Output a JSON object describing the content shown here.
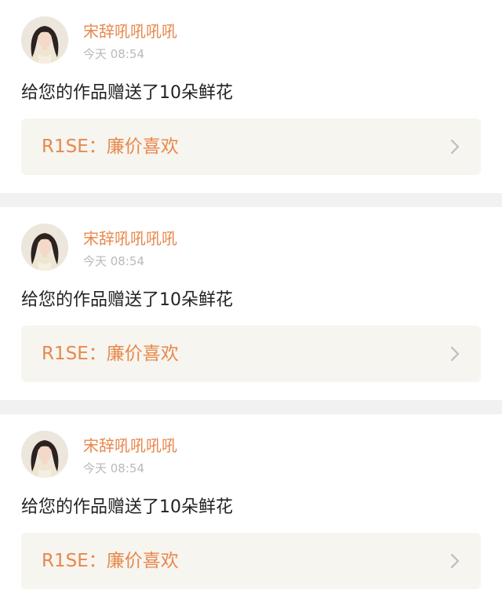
{
  "colors": {
    "accent": "#e8884c",
    "timestamp": "#b9b9b9",
    "text": "#222222",
    "link_bg": "#f6f5f0",
    "separator": "#f1f1f1"
  },
  "notifications": [
    {
      "avatar_icon": "user-avatar-icon",
      "username": "宋辞吼吼吼吼",
      "time": "今天 08:54",
      "message": "给您的作品赠送了10朵鲜花",
      "work_title": "R1SE：廉价喜欢",
      "chevron_icon": "chevron-right-icon"
    },
    {
      "avatar_icon": "user-avatar-icon",
      "username": "宋辞吼吼吼吼",
      "time": "今天 08:54",
      "message": "给您的作品赠送了10朵鲜花",
      "work_title": "R1SE：廉价喜欢",
      "chevron_icon": "chevron-right-icon"
    },
    {
      "avatar_icon": "user-avatar-icon",
      "username": "宋辞吼吼吼吼",
      "time": "今天 08:54",
      "message": "给您的作品赠送了10朵鲜花",
      "work_title": "R1SE：廉价喜欢",
      "chevron_icon": "chevron-right-icon"
    }
  ]
}
